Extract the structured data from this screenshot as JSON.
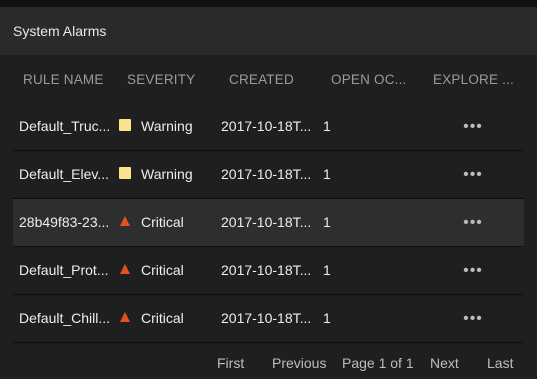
{
  "panel": {
    "title": "System Alarms"
  },
  "columns": {
    "rule_name": "RULE NAME",
    "severity": "SEVERITY",
    "created": "CREATED",
    "open_occurrences": "OPEN OC...",
    "explore": "EXPLORE ..."
  },
  "rows": [
    {
      "rule_name": "Default_Truc...",
      "severity": "Warning",
      "severity_icon": "square-warning-icon",
      "created": "2017-10-18T...",
      "open": "1",
      "more": "•••"
    },
    {
      "rule_name": "Default_Elev...",
      "severity": "Warning",
      "severity_icon": "square-warning-icon",
      "created": "2017-10-18T...",
      "open": "1",
      "more": "•••"
    },
    {
      "rule_name": "28b49f83-23...",
      "severity": "Critical",
      "severity_icon": "triangle-critical-icon",
      "created": "2017-10-18T...",
      "open": "1",
      "more": "•••"
    },
    {
      "rule_name": "Default_Prot...",
      "severity": "Critical",
      "severity_icon": "triangle-critical-icon",
      "created": "2017-10-18T...",
      "open": "1",
      "more": "•••"
    },
    {
      "rule_name": "Default_Chill...",
      "severity": "Critical",
      "severity_icon": "triangle-critical-icon",
      "created": "2017-10-18T...",
      "open": "1",
      "more": "•••"
    }
  ],
  "pagination": {
    "first": "First",
    "previous": "Previous",
    "page_info": "Page 1 of 1",
    "next": "Next",
    "last": "Last"
  },
  "colors": {
    "warning": "#f7e48c",
    "critical": "#e3511c",
    "background": "#1f1f1f",
    "header_bg": "#2a2a2a",
    "highlight_row": "#2e2e2e"
  }
}
